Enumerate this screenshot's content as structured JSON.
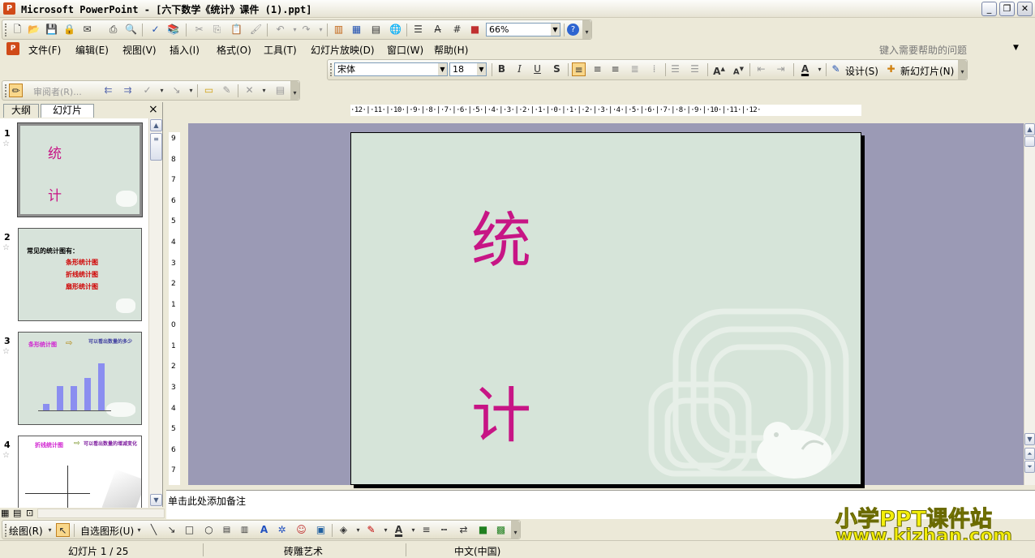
{
  "window": {
    "title": "Microsoft PowerPoint - [六下数学《统计》课件 (1).ppt]",
    "min_label": "_",
    "restore_label": "❐",
    "close_label": "✕"
  },
  "menu": {
    "items": [
      "文件(F)",
      "编辑(E)",
      "视图(V)",
      "插入(I)",
      "格式(O)",
      "工具(T)",
      "幻灯片放映(D)",
      "窗口(W)",
      "帮助(H)"
    ],
    "help_placeholder": "键入需要帮助的问题"
  },
  "standard_toolbar": {
    "zoom": "66%"
  },
  "format_toolbar": {
    "font": "宋体",
    "size": "18",
    "bold": "B",
    "italic": "I",
    "underline": "U",
    "shadow": "S",
    "design_label": "设计(S)",
    "new_slide_label": "新幻灯片(N)"
  },
  "review_toolbar": {
    "reviewer_label": "审阅者(R)..."
  },
  "outline_pane": {
    "tabs": [
      "大纲",
      "幻灯片"
    ],
    "close_label": "×",
    "thumbnails": [
      {
        "number": "1",
        "lines": [
          "统",
          "计"
        ]
      },
      {
        "number": "2",
        "heading": "常见的统计图有：",
        "lines": [
          "条形统计图",
          "折线统计图",
          "扇形统计图"
        ]
      },
      {
        "number": "3",
        "left_title": "条形统计图",
        "right_title": "可以看出数量的多少",
        "bars": [
          8,
          30,
          30,
          40,
          58
        ]
      },
      {
        "number": "4",
        "left_title": "折线统计图",
        "right_title": "可以看出数量的增减变化"
      }
    ]
  },
  "slide": {
    "char1": "统",
    "char2": "计"
  },
  "ruler": {
    "horizontal": "·12·|·11·|·10·|·9·|·8·|·7·|·6·|·5·|·4·|·3·|·2·|·1·|·0·|·1·|·2·|·3·|·4·|·5·|·6·|·7·|·8·|·9·|·10·|·11·|·12·",
    "vertical": [
      "9",
      "8",
      "7",
      "6",
      "5",
      "4",
      "3",
      "2",
      "1",
      "0",
      "1",
      "2",
      "3",
      "4",
      "5",
      "6",
      "7"
    ]
  },
  "notes": {
    "placeholder": "单击此处添加备注"
  },
  "drawing_toolbar": {
    "draw_label": "绘图(R)",
    "autoshape_label": "自选图形(U)"
  },
  "status_bar": {
    "slide_info": "幻灯片 1 / 25",
    "template": "砖雕艺术",
    "language": "中文(中国)"
  },
  "watermark": {
    "line1": "小学PPT课件站",
    "line2": "www.kjzhan.com"
  },
  "colors": {
    "accent_magenta": "#c71585",
    "slide_bg": "#d6e4d9",
    "canvas_bg": "#9b9ab5"
  }
}
